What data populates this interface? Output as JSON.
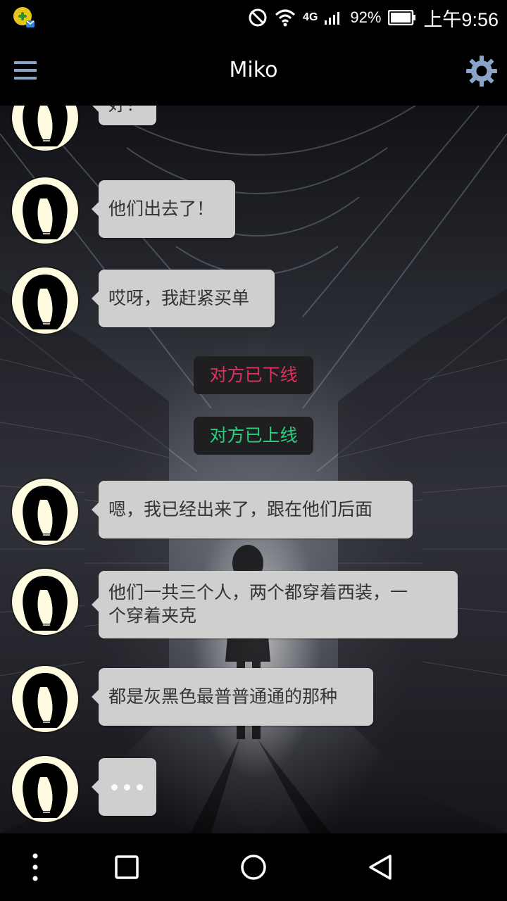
{
  "status_bar": {
    "network_label": "4G",
    "battery_percent": "92%",
    "time": "上午9:56"
  },
  "app_bar": {
    "title": "Miko",
    "menu_icon": "hamburger-menu-icon",
    "settings_icon": "gear-icon"
  },
  "messages": [
    {
      "type": "incoming",
      "text": "好！"
    },
    {
      "type": "incoming",
      "text": "他们出去了！"
    },
    {
      "type": "incoming",
      "text": "哎呀，我赶紧买单"
    },
    {
      "type": "system",
      "text": "对方已下线",
      "color": "#e0305e"
    },
    {
      "type": "system",
      "text": "对方已上线",
      "color": "#27d07a"
    },
    {
      "type": "incoming",
      "text": "嗯，我已经出来了，跟在他们后面"
    },
    {
      "type": "incoming",
      "lines": [
        "他们一共三个人，两个都穿着西装，一",
        "个穿着夹克"
      ]
    },
    {
      "type": "incoming",
      "text": "都是灰黑色最普普通通的那种"
    },
    {
      "type": "typing",
      "indicator": "typing-dots"
    }
  ],
  "nav_bar": {
    "icons": [
      "more-vertical-icon",
      "square-recents-icon",
      "circle-home-icon",
      "triangle-back-icon"
    ]
  },
  "colors": {
    "accent_gear": "#8aa3c8",
    "bubble_bg": "#cfcfcf",
    "avatar_bg": "#fffbe1"
  }
}
